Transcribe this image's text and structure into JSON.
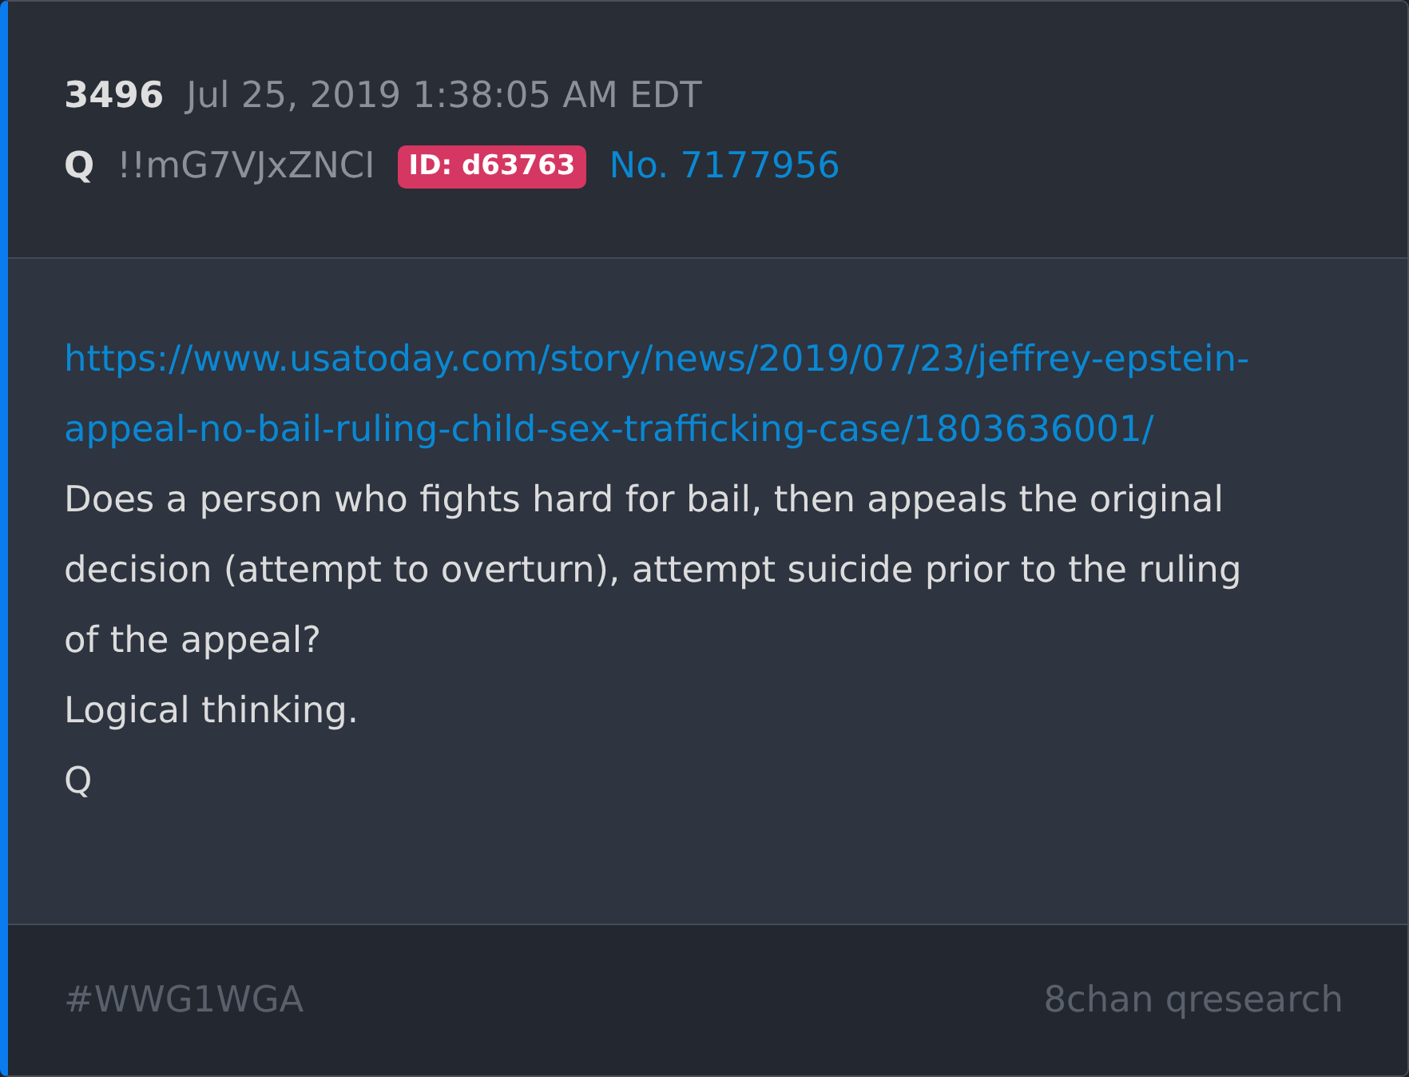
{
  "post": {
    "number": "3496",
    "date": "Jul 25, 2019 1:38:05 AM EDT",
    "author": "Q",
    "tripcode": "!!mG7VJxZNCI",
    "id_badge": "ID: d63763",
    "post_no": "No. 7177956"
  },
  "body": [
    {
      "kind": "link",
      "text": "https://www.usatoday.com/story/news/2019/07/23/jeffrey-epstein-appeal-no-bail-ruling-child-sex-trafficking-case/1803636001/"
    },
    {
      "kind": "text",
      "text": "Does a person who fights hard for bail, then appeals the original decision (attempt to overturn), attempt suicide prior to the ruling of the appeal?"
    },
    {
      "kind": "text",
      "text": "Logical thinking."
    },
    {
      "kind": "text",
      "text": "Q"
    }
  ],
  "footer": {
    "hashtag": "#WWG1WGA",
    "source": "8chan qresearch"
  }
}
